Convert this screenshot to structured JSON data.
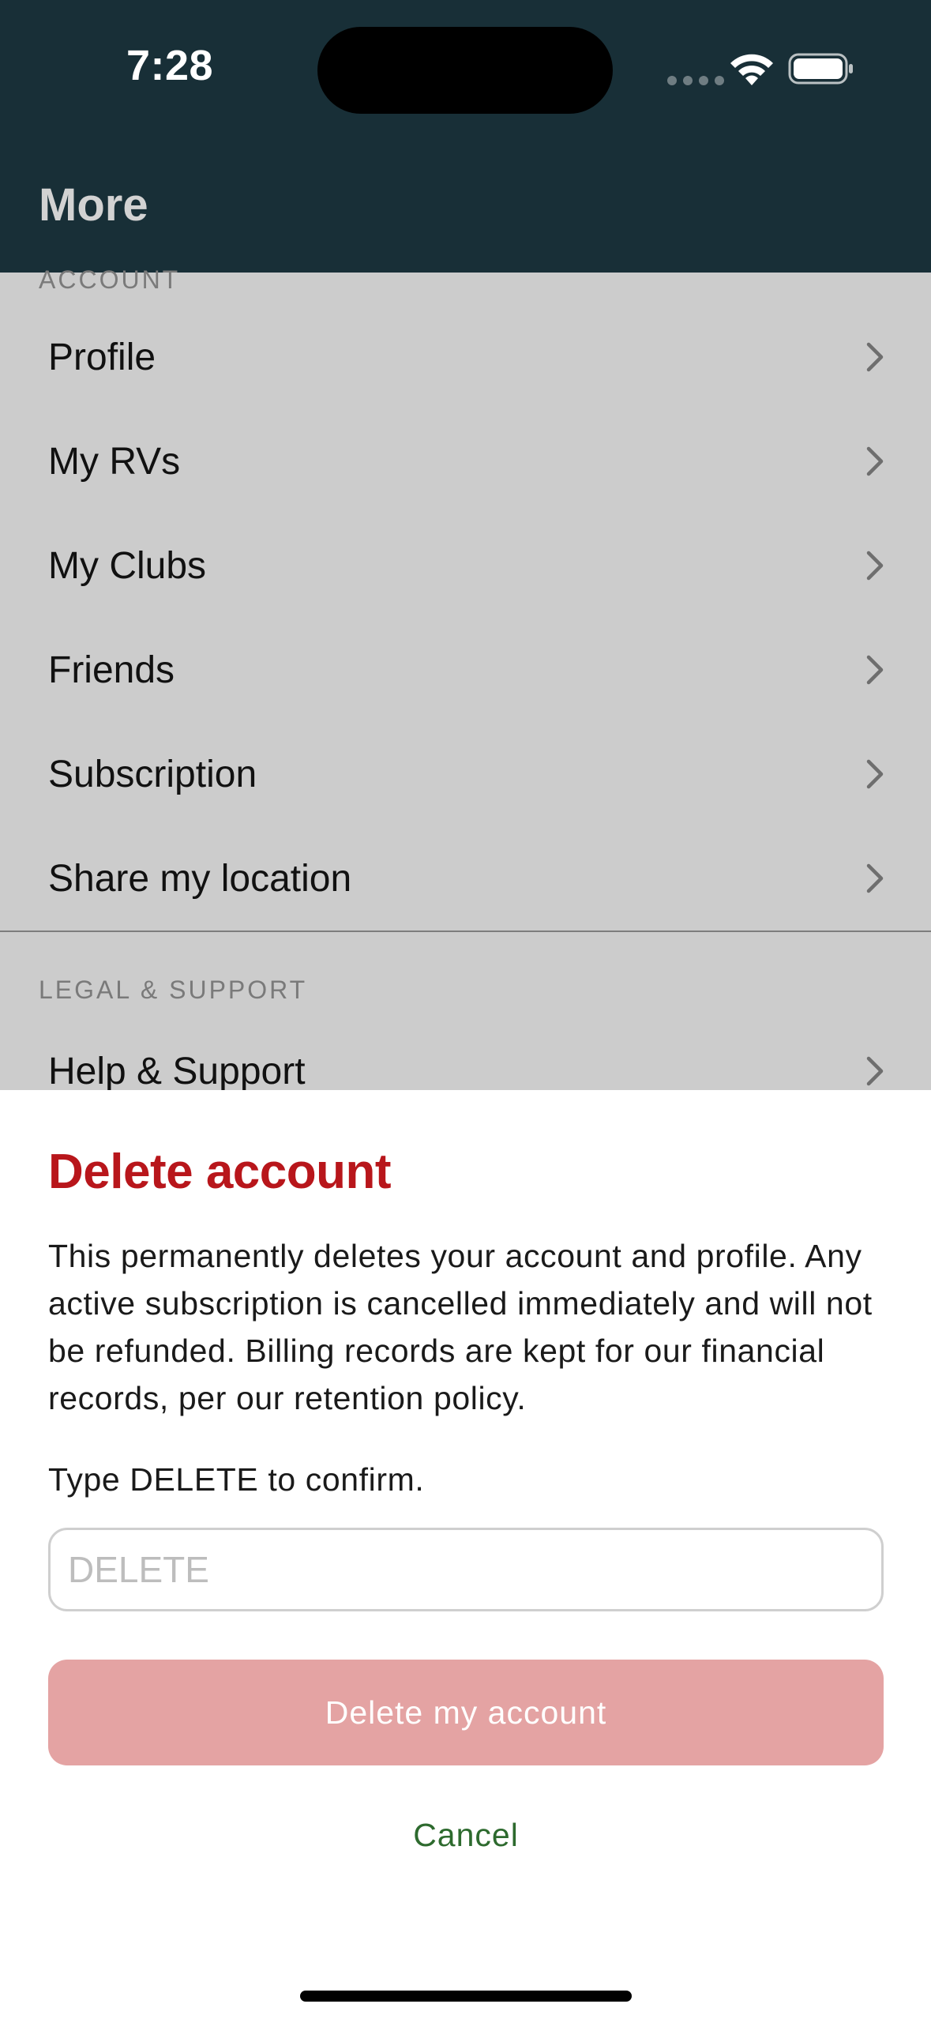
{
  "status_bar": {
    "time": "7:28"
  },
  "header": {
    "title": "More"
  },
  "sections": {
    "account": {
      "label": "ACCOUNT",
      "items": [
        {
          "label": "Profile"
        },
        {
          "label": "My RVs"
        },
        {
          "label": "My Clubs"
        },
        {
          "label": "Friends"
        },
        {
          "label": "Subscription"
        },
        {
          "label": "Share my location"
        }
      ]
    },
    "legal": {
      "label": "LEGAL & SUPPORT",
      "items": [
        {
          "label": "Help & Support"
        }
      ]
    }
  },
  "sheet": {
    "title": "Delete account",
    "body": "This permanently deletes your account and profile. Any active subscription is cancelled immediately and will not be refunded. Billing records are kept for our financial records, per our retention policy.",
    "confirm_label": "Type DELETE to confirm.",
    "input_placeholder": "DELETE",
    "input_value": "",
    "delete_button_label": "Delete my account",
    "cancel_label": "Cancel"
  },
  "colors": {
    "header_bg": "#182f37",
    "danger": "#b8161b",
    "danger_disabled": "#e4a3a3",
    "cancel": "#2d6a2e",
    "dim_overlay": "#cccccc"
  }
}
